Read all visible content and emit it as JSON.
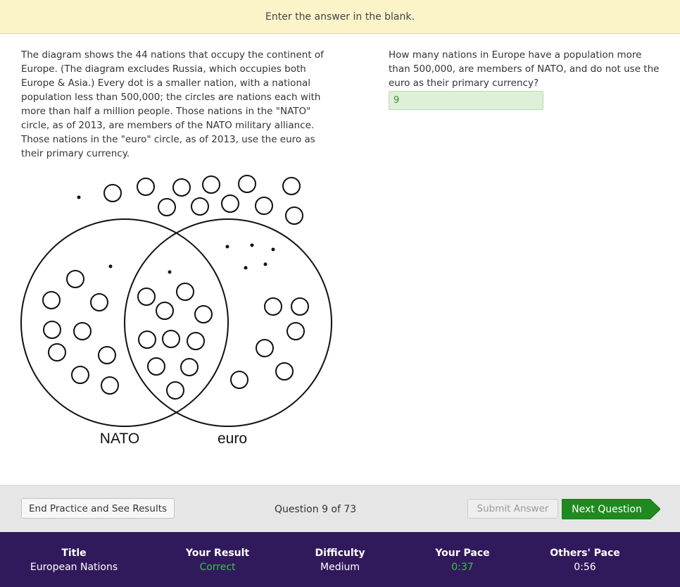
{
  "banner": {
    "text": "Enter the answer in the blank."
  },
  "passage": {
    "text": "The diagram shows the 44 nations that occupy the continent of Europe.  (The diagram excludes Russia, which occupies both Europe & Asia.)  Every dot is a smaller nation, with a national population less than 500,000; the circles are nations each with more than half a million people.  Those nations in the \"NATO\" circle, as of 2013, are members of the NATO military alliance.  Those nations in the \"euro\" circle, as of 2013, use the euro as their primary currency."
  },
  "diagram": {
    "left_label": "NATO",
    "right_label": "euro"
  },
  "question": {
    "text": "How many nations in Europe have a population more than 500,000, are members of NATO, and do not use the euro as their primary currency?",
    "answer_value": "9"
  },
  "controls": {
    "end_label": "End Practice and See Results",
    "counter": "Question 9 of 73",
    "submit_label": "Submit Answer",
    "next_label": "Next Question"
  },
  "footer": {
    "title_label": "Title",
    "title_value": "European Nations",
    "result_label": "Your Result",
    "result_value": "Correct",
    "difficulty_label": "Difficulty",
    "difficulty_value": "Medium",
    "pace_label": "Your Pace",
    "pace_value": "0:37",
    "others_label": "Others' Pace",
    "others_value": "0:56"
  },
  "colors": {
    "banner": "#fcf4c9",
    "answer_bg": "#dff0d8",
    "next_button": "#1f8a1f",
    "footer": "#301a5c",
    "good": "#3fbf4a"
  }
}
